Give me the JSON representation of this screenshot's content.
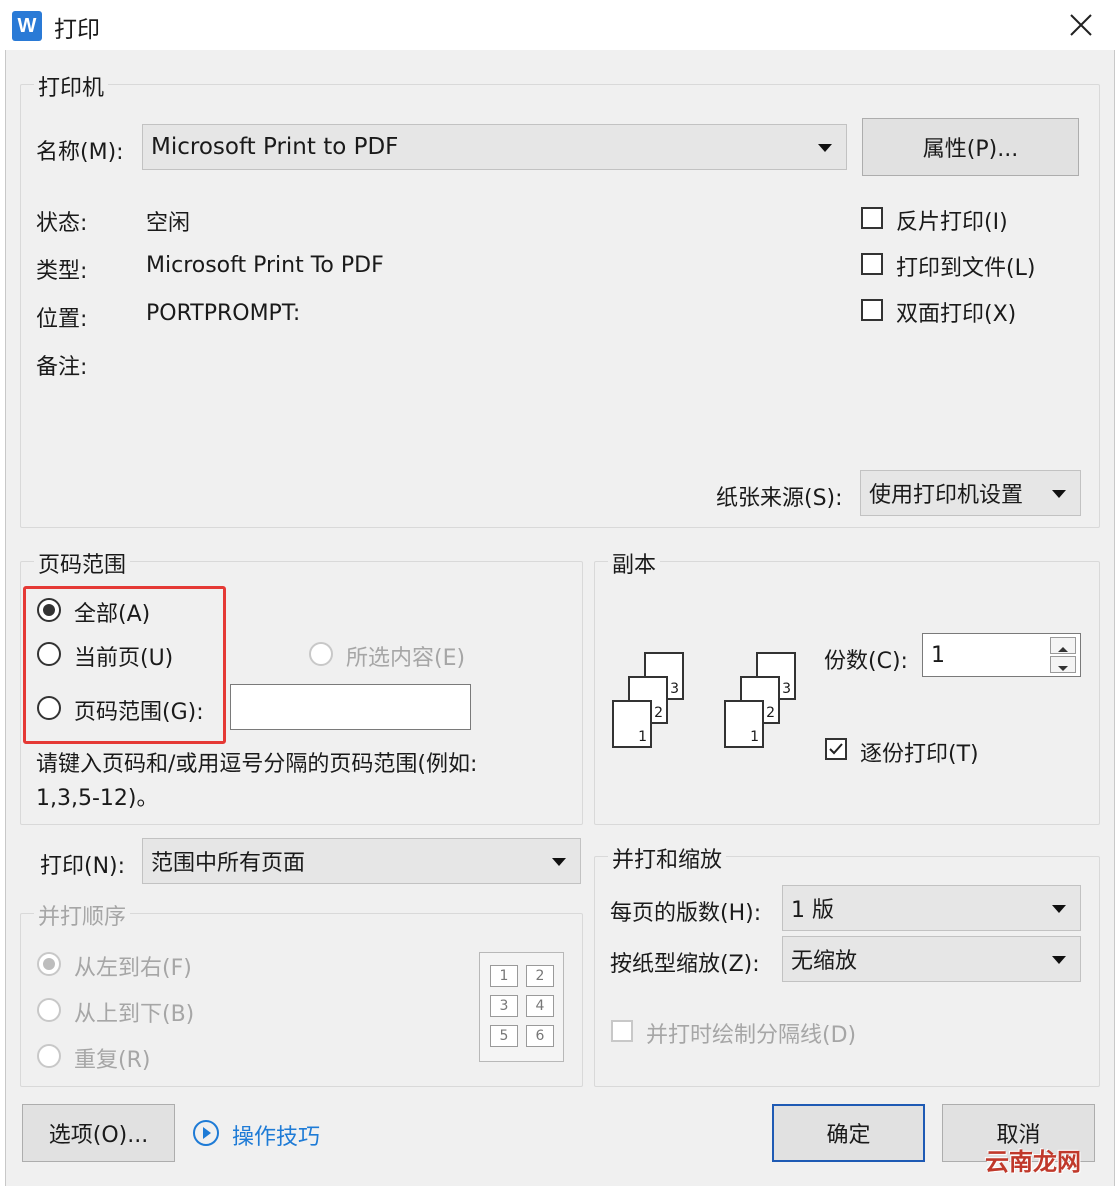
{
  "window": {
    "title": "打印",
    "app_icon": "W"
  },
  "printer": {
    "group_title": "打印机",
    "name_label": "名称(M):",
    "name_value": "Microsoft Print to PDF",
    "properties_button": "属性(P)...",
    "status_label": "状态:",
    "status_value": "空闲",
    "type_label": "类型:",
    "type_value": "Microsoft Print To PDF",
    "location_label": "位置:",
    "location_value": "PORTPROMPT:",
    "comment_label": "备注:",
    "reverse_print": {
      "label": "反片打印(I)",
      "checked": false
    },
    "print_to_file": {
      "label": "打印到文件(L)",
      "checked": false
    },
    "duplex": {
      "label": "双面打印(X)",
      "checked": false
    },
    "paper_source_label": "纸张来源(S):",
    "paper_source_value": "使用打印机设置"
  },
  "page_range": {
    "group_title": "页码范围",
    "all": {
      "label": "全部(A)",
      "selected": true
    },
    "current": {
      "label": "当前页(U)",
      "selected": false
    },
    "selection": {
      "label": "所选内容(E)",
      "enabled": false
    },
    "pages": {
      "label": "页码范围(G):",
      "value": ""
    },
    "hint_line1": "请键入页码和/或用逗号分隔的页码范围(例如:",
    "hint_line2": "1,3,5-12)。"
  },
  "copies": {
    "group_title": "副本",
    "count_label": "份数(C):",
    "count_value": "1",
    "collate": {
      "label": "逐份打印(T)",
      "checked": true
    },
    "page_numbers": [
      "1",
      "2",
      "3"
    ]
  },
  "print_what": {
    "label": "打印(N):",
    "value": "范围中所有页面"
  },
  "print_order": {
    "group_title": "并打顺序",
    "left_to_right": "从左到右(F)",
    "top_to_bottom": "从上到下(B)",
    "repeat": "重复(R)",
    "grid": [
      "1",
      "2",
      "3",
      "4",
      "5",
      "6"
    ]
  },
  "zoom": {
    "group_title": "并打和缩放",
    "pages_per_sheet_label": "每页的版数(H):",
    "pages_per_sheet_value": "1 版",
    "scale_label": "按纸型缩放(Z):",
    "scale_value": "无缩放",
    "draw_borders": {
      "label": "并打时绘制分隔线(D)",
      "enabled": false
    }
  },
  "footer": {
    "options_button": "选项(O)...",
    "tips_link": "操作技巧",
    "ok_button": "确定",
    "cancel_button": "取消"
  },
  "watermark": "云南龙网",
  "colors": {
    "highlight": "#e53935",
    "link": "#1e7bd6",
    "ok_border": "#1e5ab4"
  }
}
